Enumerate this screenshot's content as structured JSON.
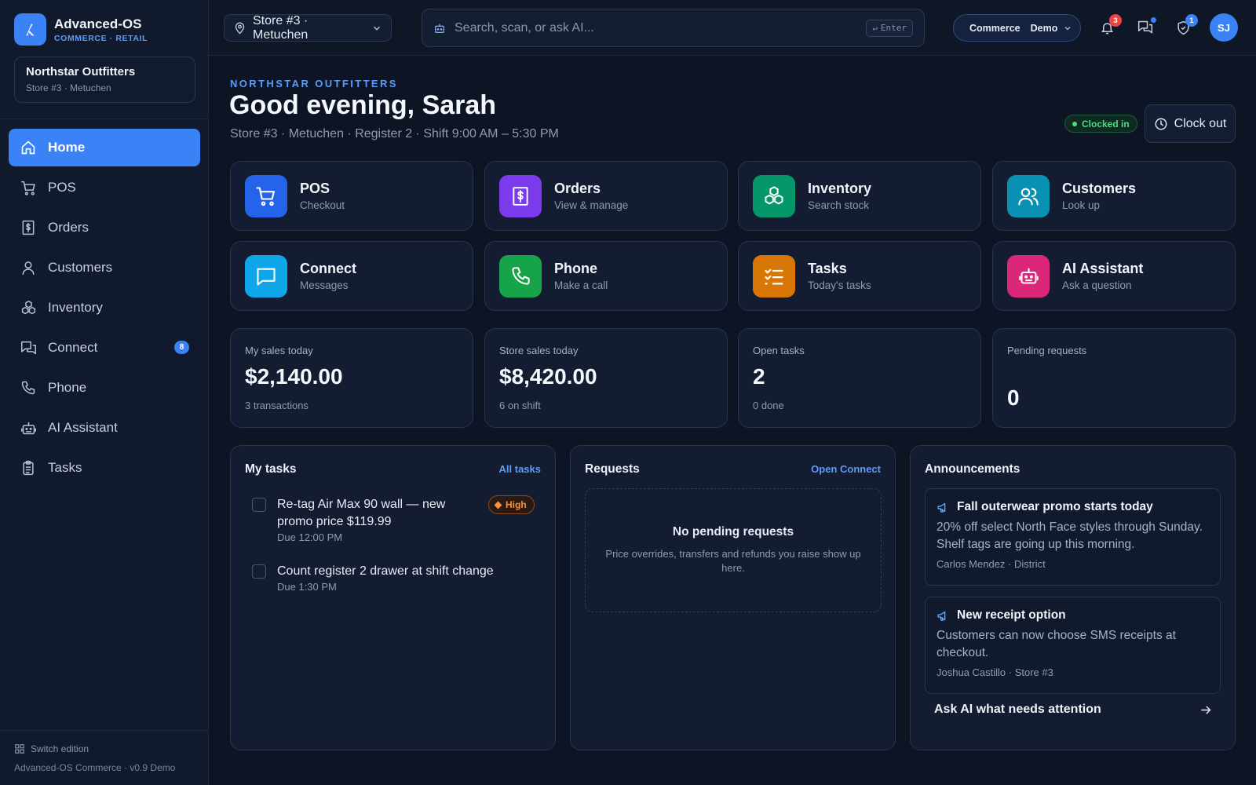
{
  "brand": {
    "name": "Advanced-OS",
    "subtitle": "COMMERCE · RETAIL"
  },
  "store_card": {
    "name": "Northstar Outfitters",
    "location": "Store #3 · Metuchen"
  },
  "sidebar": {
    "items": [
      {
        "label": "Home",
        "icon": "home-icon",
        "active": true
      },
      {
        "label": "POS",
        "icon": "cart-icon"
      },
      {
        "label": "Orders",
        "icon": "receipt-icon"
      },
      {
        "label": "Customers",
        "icon": "user-icon"
      },
      {
        "label": "Inventory",
        "icon": "boxes-icon"
      },
      {
        "label": "Connect",
        "icon": "chat-icon",
        "badge": "8"
      },
      {
        "label": "Phone",
        "icon": "phone-icon"
      },
      {
        "label": "AI Assistant",
        "icon": "bot-icon"
      },
      {
        "label": "Tasks",
        "icon": "clipboard-icon"
      }
    ],
    "switch_label": "Switch edition",
    "version": "Advanced-OS Commerce · v0.9 Demo"
  },
  "topbar": {
    "store_selector": "Store #3 · Metuchen",
    "search_placeholder": "Search, scan, or ask AI...",
    "enter_hint": "Enter",
    "edition_a": "Commerce",
    "edition_b": "Demo",
    "notifications_count": "3",
    "tasks_count": "1",
    "avatar": "SJ"
  },
  "header": {
    "eyebrow": "NORTHSTAR OUTFITTERS",
    "greeting": "Good evening, Sarah",
    "subline": "Store #3 · Metuchen · Register 2 · Shift 9:00 AM – 5:30 PM",
    "status": "Clocked in",
    "clock_out": "Clock out"
  },
  "tiles": [
    {
      "title": "POS",
      "subtitle": "Checkout",
      "icon": "cart-icon",
      "color": "#2563eb"
    },
    {
      "title": "Orders",
      "subtitle": "View & manage",
      "icon": "receipt-icon",
      "color": "#7c3aed"
    },
    {
      "title": "Inventory",
      "subtitle": "Search stock",
      "icon": "boxes-icon",
      "color": "#059669"
    },
    {
      "title": "Customers",
      "subtitle": "Look up",
      "icon": "users-icon",
      "color": "#0891b2"
    },
    {
      "title": "Connect",
      "subtitle": "Messages",
      "icon": "message-icon",
      "color": "#0ea5e9"
    },
    {
      "title": "Phone",
      "subtitle": "Make a call",
      "icon": "phone-icon",
      "color": "#16a34a"
    },
    {
      "title": "Tasks",
      "subtitle": "Today's tasks",
      "icon": "list-check-icon",
      "color": "#d97706"
    },
    {
      "title": "AI Assistant",
      "subtitle": "Ask a question",
      "icon": "bot-icon",
      "color": "#db2777"
    }
  ],
  "stats": [
    {
      "label": "My sales today",
      "value": "$2,140.00",
      "sub": "3 transactions"
    },
    {
      "label": "Store sales today",
      "value": "$8,420.00",
      "sub": "6 on shift"
    },
    {
      "label": "Open tasks",
      "value": "2",
      "sub": "0 done"
    },
    {
      "label": "Pending requests",
      "value": "0",
      "sub": ""
    }
  ],
  "my_tasks": {
    "title": "My tasks",
    "link": "All tasks",
    "items": [
      {
        "title": "Re-tag Air Max 90 wall — new promo price $119.99",
        "due": "Due 12:00 PM",
        "priority": "High"
      },
      {
        "title": "Count register 2 drawer at shift change",
        "due": "Due 1:30 PM"
      }
    ]
  },
  "requests": {
    "title": "Requests",
    "link": "Open Connect",
    "empty_title": "No pending requests",
    "empty_desc": "Price overrides, transfers and refunds you raise show up here."
  },
  "announcements": {
    "title": "Announcements",
    "items": [
      {
        "title": "Fall outerwear promo starts today",
        "body": "20% off select North Face styles through Sunday. Shelf tags are going up this morning.",
        "author": "Carlos Mendez · District"
      },
      {
        "title": "New receipt option",
        "body": "Customers can now choose SMS receipts at checkout.",
        "author": "Joshua Castillo · Store #3"
      }
    ],
    "ask_ai": "Ask AI what needs attention"
  }
}
